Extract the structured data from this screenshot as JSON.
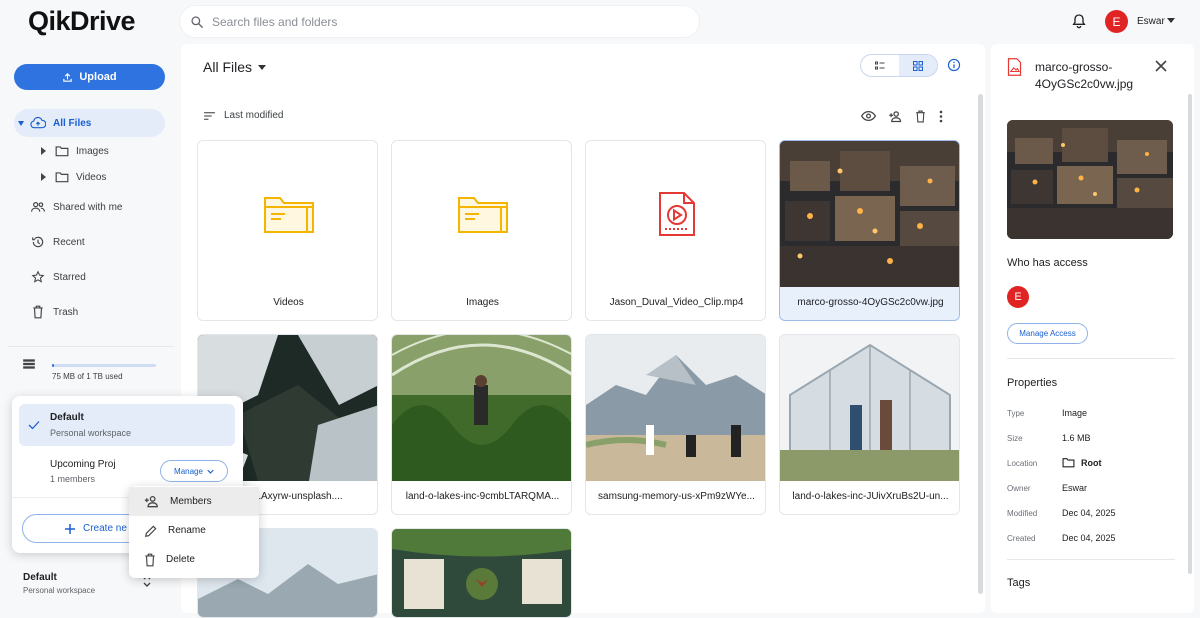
{
  "app": {
    "logo": "QikDrive"
  },
  "search": {
    "placeholder": "Search files and folders"
  },
  "user": {
    "initial": "E",
    "name": "Eswar"
  },
  "sidebar": {
    "upload_label": "Upload",
    "items": [
      {
        "label": "All Files"
      },
      {
        "label": "Images"
      },
      {
        "label": "Videos"
      },
      {
        "label": "Shared with me"
      },
      {
        "label": "Recent"
      },
      {
        "label": "Starred"
      },
      {
        "label": "Trash"
      }
    ],
    "storage_text": "75 MB of 1 TB used",
    "storage_fraction": 0.02
  },
  "workspace_popup": {
    "default_name": "Default",
    "default_sub": "Personal workspace",
    "proj_name": "Upcoming Proj",
    "proj_sub": "1 members",
    "manage_label": "Manage",
    "create_label": "Create ne"
  },
  "context_menu": {
    "members": "Members",
    "rename": "Rename",
    "delete": "Delete"
  },
  "workspace_current": {
    "name": "Default",
    "sub": "Personal workspace"
  },
  "main": {
    "title": "All Files",
    "sort_label": "Last modified",
    "files": [
      {
        "name": "Videos",
        "kind": "folder"
      },
      {
        "name": "Images",
        "kind": "folder"
      },
      {
        "name": "Jason_Duval_Video_Clip.mp4",
        "kind": "video"
      },
      {
        "name": "marco-grosso-4OyGSc2c0vw.jpg",
        "kind": "image"
      },
      {
        "name": "l0SA1Axyrw-unsplash....",
        "kind": "image"
      },
      {
        "name": "land-o-lakes-inc-9cmbLTARQMA...",
        "kind": "image"
      },
      {
        "name": "samsung-memory-us-xPm9zWYe...",
        "kind": "image"
      },
      {
        "name": "land-o-lakes-inc-JUivXruBs2U-un...",
        "kind": "image"
      },
      {
        "name": "",
        "kind": "image"
      },
      {
        "name": "",
        "kind": "image"
      }
    ]
  },
  "details": {
    "title": "marco-grosso-4OyGSc2c0vw.jpg",
    "who_has_access": "Who has access",
    "access_initial": "E",
    "manage_access": "Manage Access",
    "properties_heading": "Properties",
    "properties": [
      {
        "key": "Type",
        "value": "Image"
      },
      {
        "key": "Size",
        "value": "1.6 MB"
      },
      {
        "key": "Location",
        "value": "Root"
      },
      {
        "key": "Owner",
        "value": "Eswar"
      },
      {
        "key": "Modified",
        "value": "Dec 04, 2025"
      },
      {
        "key": "Created",
        "value": "Dec 04, 2025"
      }
    ],
    "tags_heading": "Tags"
  },
  "colors": {
    "accent": "#2f73e0",
    "avatar": "#e02424",
    "folder": "#f4b400",
    "video": "#e53935"
  }
}
